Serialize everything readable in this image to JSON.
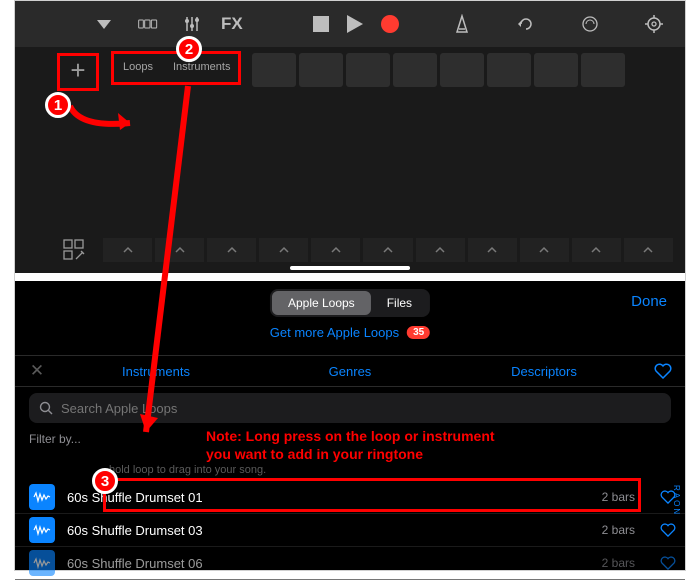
{
  "toolbar": {
    "fx_label": "FX"
  },
  "segments": {
    "loops_label": "Loops",
    "instruments_label": "Instruments"
  },
  "browser": {
    "apple_loops_tab": "Apple Loops",
    "files_tab": "Files",
    "done_label": "Done",
    "get_more_label": "Get more Apple Loops",
    "get_more_badge": "35",
    "filter_instruments": "Instruments",
    "filter_genres": "Genres",
    "filter_descriptors": "Descriptors",
    "search_placeholder": "Search Apple Loops",
    "filter_by_label": "Filter by...",
    "hint_text": "hold loop to drag into your song.",
    "side_label": "RAON",
    "loops": [
      {
        "name": "60s Shuffle Drumset 01",
        "bars": "2 bars"
      },
      {
        "name": "60s Shuffle Drumset 03",
        "bars": "2 bars"
      },
      {
        "name": "60s Shuffle Drumset 06",
        "bars": "2 bars"
      }
    ]
  },
  "annotations": {
    "marker1": "1",
    "marker2": "2",
    "marker3": "3",
    "note_line1": "Note: Long press on the loop or instrument",
    "note_line2": "you want to add in your ringtone"
  }
}
